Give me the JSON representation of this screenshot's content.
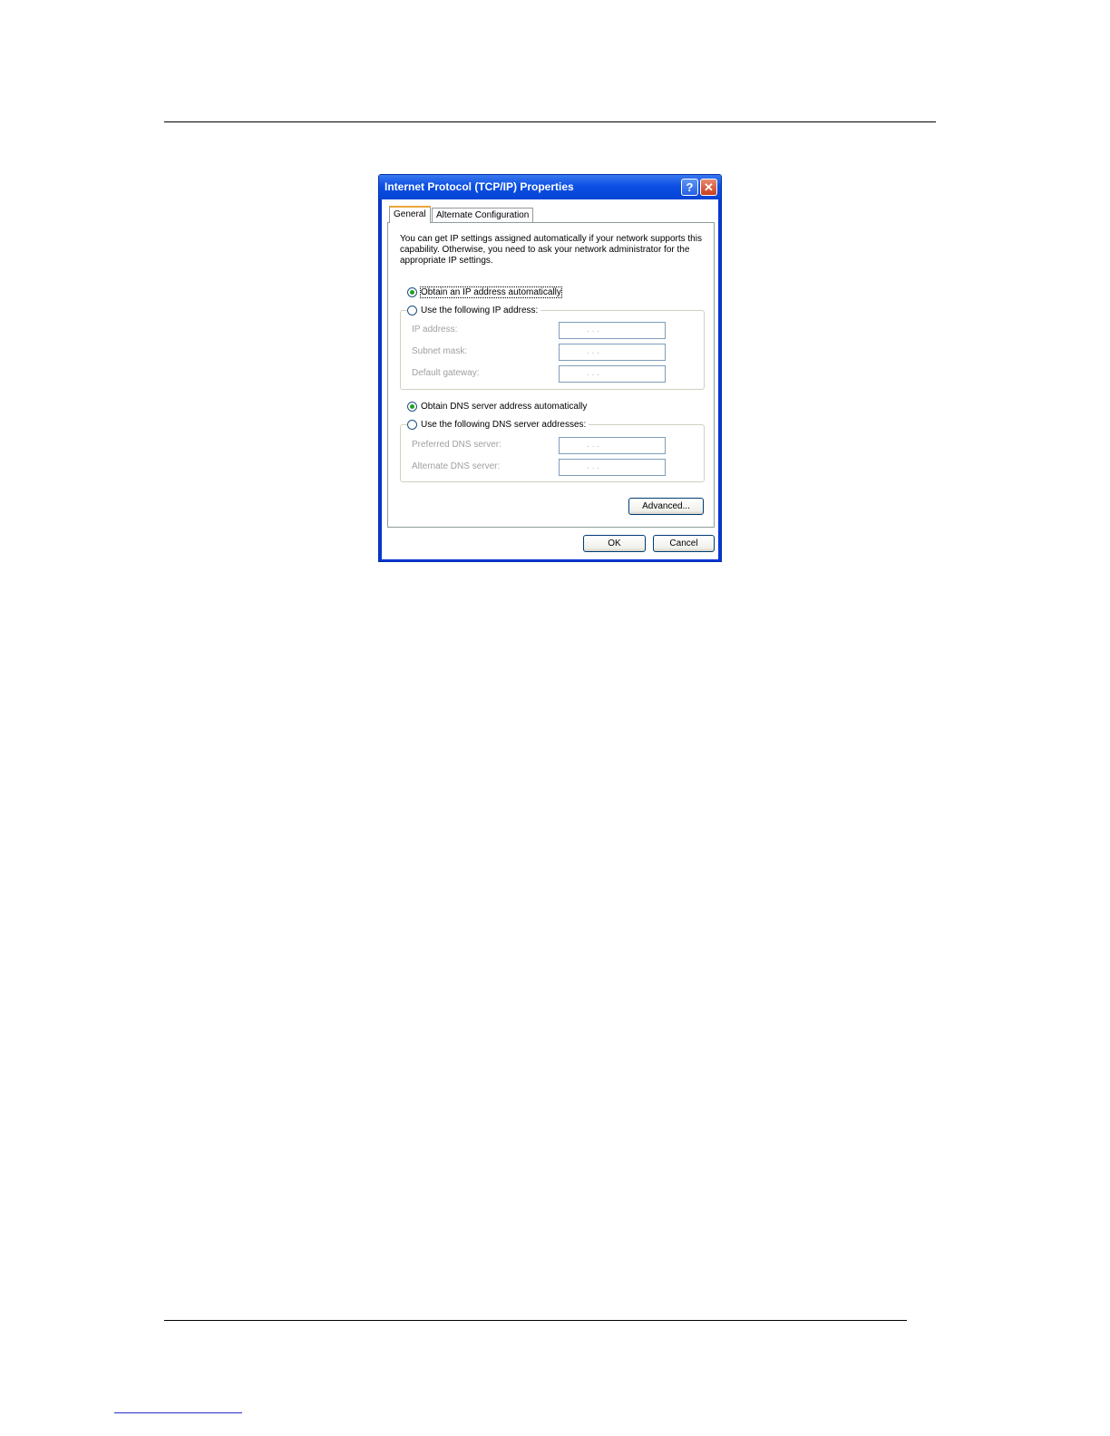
{
  "dialog": {
    "title": "Internet Protocol (TCP/IP) Properties",
    "help_glyph": "?",
    "close_glyph": "✕",
    "tabs": [
      {
        "label": "General",
        "selected": true
      },
      {
        "label": "Alternate Configuration",
        "selected": false
      }
    ],
    "intro_text": "You can get IP settings assigned automatically if your network supports this capability. Otherwise, you need to ask your network administrator for the appropriate IP settings.",
    "ip": {
      "obtain_auto_label": "Obtain an IP address automatically",
      "obtain_auto_selected": true,
      "use_following_label": "Use the following IP address:",
      "use_following_selected": false,
      "fields": [
        {
          "label": "IP address:",
          "value": ".   .   ."
        },
        {
          "label": "Subnet mask:",
          "value": ".   .   ."
        },
        {
          "label": "Default gateway:",
          "value": ".   .   ."
        }
      ]
    },
    "dns": {
      "obtain_auto_label": "Obtain DNS server address automatically",
      "obtain_auto_selected": true,
      "use_following_label": "Use the following DNS server addresses:",
      "use_following_selected": false,
      "fields": [
        {
          "label": "Preferred DNS server:",
          "value": ".   .   ."
        },
        {
          "label": "Alternate DNS server:",
          "value": ".   .   ."
        }
      ]
    },
    "advanced_label": "Advanced...",
    "ok_label": "OK",
    "cancel_label": "Cancel"
  },
  "colors": {
    "titlebar": "#0a4fe3",
    "radio_dot": "#21a121",
    "tab_highlight": "#e8a63a"
  }
}
